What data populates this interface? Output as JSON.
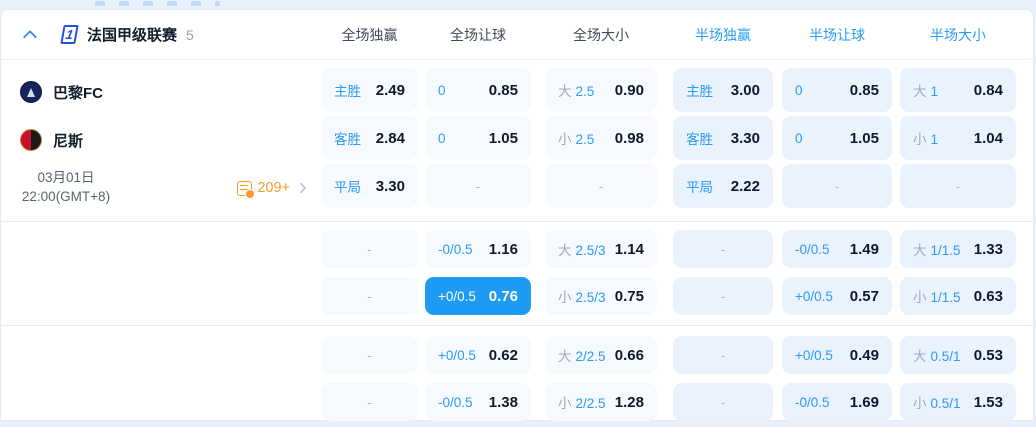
{
  "header": {
    "league_name": "法国甲级联赛",
    "match_count": "5",
    "columns": [
      {
        "key": "fulltime-1x2",
        "label": "全场独赢",
        "half": false
      },
      {
        "key": "fulltime-handicap",
        "label": "全场让球",
        "half": false
      },
      {
        "key": "fulltime-ou",
        "label": "全场大小",
        "half": false
      },
      {
        "key": "halftime-1x2",
        "label": "半场独赢",
        "half": true
      },
      {
        "key": "halftime-handicap",
        "label": "半场让球",
        "half": true
      },
      {
        "key": "halftime-ou",
        "label": "半场大小",
        "half": true
      }
    ]
  },
  "match": {
    "home_team": "巴黎FC",
    "away_team": "尼斯",
    "date": "03月01日",
    "time": "22:00(GMT+8)",
    "more_markets": "209+"
  },
  "colors": {
    "accent_blue": "#2b9bf3",
    "highlight_cell": "#1d9bf2",
    "orange": "#f89b30",
    "half_cell_bg": "#e9f2fd",
    "full_cell_bg": "#f6f9fd"
  },
  "odds_blocks": [
    {
      "rows": [
        [
          {
            "b": "主胜",
            "v": "2.49"
          },
          {
            "b": "0",
            "v": "0.85"
          },
          {
            "g": "大",
            "b": "2.5",
            "v": "0.90"
          },
          {
            "b": "主胜",
            "v": "3.00"
          },
          {
            "b": "0",
            "v": "0.85"
          },
          {
            "g": "大",
            "b": "1",
            "v": "0.84"
          }
        ],
        [
          {
            "b": "客胜",
            "v": "2.84"
          },
          {
            "b": "0",
            "v": "1.05"
          },
          {
            "g": "小",
            "b": "2.5",
            "v": "0.98"
          },
          {
            "b": "客胜",
            "v": "3.30"
          },
          {
            "b": "0",
            "v": "1.05"
          },
          {
            "g": "小",
            "b": "1",
            "v": "1.04"
          }
        ],
        [
          {
            "b": "平局",
            "v": "3.30"
          },
          {
            "dash": "-"
          },
          {
            "dash": "-"
          },
          {
            "b": "平局",
            "v": "2.22"
          },
          {
            "dash": "-"
          },
          {
            "dash": "-"
          }
        ]
      ]
    },
    {
      "rows": [
        [
          {
            "dash": "-"
          },
          {
            "b": "-0/0.5",
            "v": "1.16"
          },
          {
            "g": "大",
            "b": "2.5/3",
            "v": "1.14"
          },
          {
            "dash": "-"
          },
          {
            "b": "-0/0.5",
            "v": "1.49"
          },
          {
            "g": "大",
            "b": "1/1.5",
            "v": "1.33"
          }
        ],
        [
          {
            "dash": "-"
          },
          {
            "b": "+0/0.5",
            "v": "0.76",
            "hl": true
          },
          {
            "g": "小",
            "b": "2.5/3",
            "v": "0.75"
          },
          {
            "dash": "-"
          },
          {
            "b": "+0/0.5",
            "v": "0.57"
          },
          {
            "g": "小",
            "b": "1/1.5",
            "v": "0.63"
          }
        ]
      ]
    },
    {
      "rows": [
        [
          {
            "dash": "-"
          },
          {
            "b": "+0/0.5",
            "v": "0.62"
          },
          {
            "g": "大",
            "b": "2/2.5",
            "v": "0.66"
          },
          {
            "dash": "-"
          },
          {
            "b": "+0/0.5",
            "v": "0.49"
          },
          {
            "g": "大",
            "b": "0.5/1",
            "v": "0.53"
          }
        ],
        [
          {
            "dash": "-"
          },
          {
            "b": "-0/0.5",
            "v": "1.38"
          },
          {
            "g": "小",
            "b": "2/2.5",
            "v": "1.28"
          },
          {
            "dash": "-"
          },
          {
            "b": "-0/0.5",
            "v": "1.69"
          },
          {
            "g": "小",
            "b": "0.5/1",
            "v": "1.53"
          }
        ]
      ]
    }
  ]
}
